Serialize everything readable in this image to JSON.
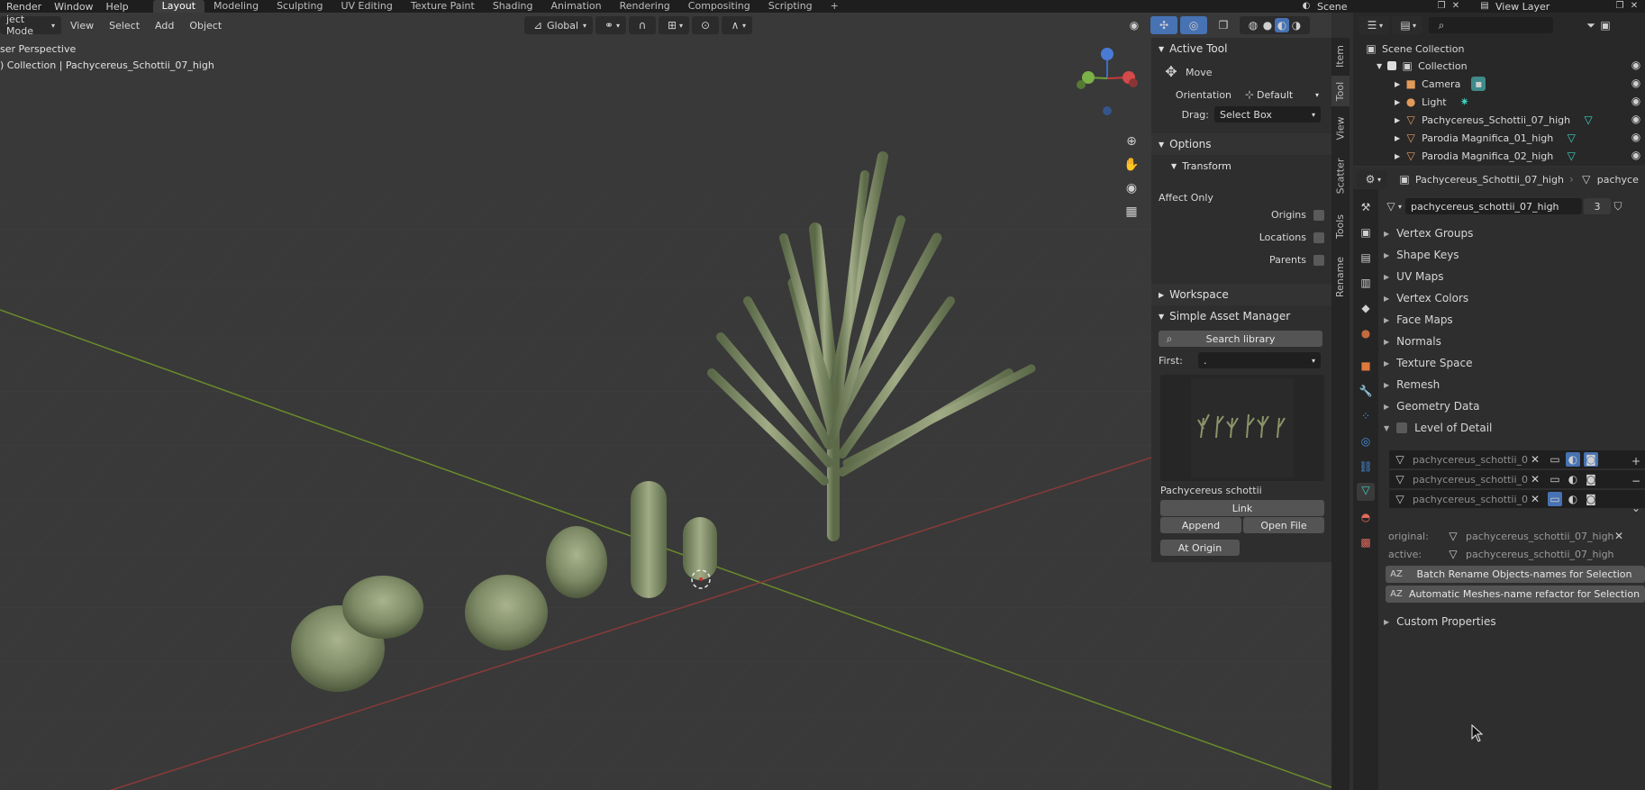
{
  "menubar": {
    "items": [
      "Render",
      "Window",
      "Help"
    ],
    "workspaces": [
      "Layout",
      "Modeling",
      "Sculpting",
      "UV Editing",
      "Texture Paint",
      "Shading",
      "Animation",
      "Rendering",
      "Compositing",
      "Scripting"
    ],
    "add_tab": "+",
    "scene": "Scene",
    "view_layer": "View Layer"
  },
  "viewport_header": {
    "mode": "ject Mode",
    "menus": [
      "View",
      "Select",
      "Add",
      "Object"
    ],
    "orientation": "Global"
  },
  "viewport": {
    "perspective": "ser Perspective",
    "collection_info": ") Collection | Pachycereus_Schottii_07_high"
  },
  "npanel": {
    "active_tool": {
      "title": "Active Tool",
      "tool_name": "Move",
      "orientation_label": "Orientation",
      "orientation_value": "Default",
      "drag_label": "Drag:",
      "drag_value": "Select Box"
    },
    "options": {
      "title": "Options",
      "transform": "Transform",
      "affect_only": "Affect Only",
      "origins": "Origins",
      "locations": "Locations",
      "parents": "Parents"
    },
    "workspace": "Workspace",
    "asset_manager": {
      "title": "Simple Asset Manager",
      "search": "Search library",
      "first_label": "First:",
      "first_value": ".",
      "asset_name": "Pachycereus schottii",
      "link": "Link",
      "append": "Append",
      "open_file": "Open File",
      "at_origin": "At Origin"
    },
    "tabs": [
      "Item",
      "Tool",
      "View",
      "Scatter",
      "Tools",
      "Rename"
    ]
  },
  "outliner": {
    "search_placeholder": "",
    "root": "Scene Collection",
    "items": [
      {
        "name": "Collection",
        "indent": 1
      },
      {
        "name": "Camera",
        "indent": 2
      },
      {
        "name": "Light",
        "indent": 2
      },
      {
        "name": "Pachycereus_Schottii_07_high",
        "indent": 2
      },
      {
        "name": "Parodia Magnifica_01_high",
        "indent": 2
      },
      {
        "name": "Parodia Magnifica_02_high",
        "indent": 2
      }
    ]
  },
  "properties": {
    "object_name": "Pachycereus_Schottii_07_high",
    "mesh_short": "pachyce",
    "mesh_name": "pachycereus_schottii_07_high",
    "users": "3",
    "sections": [
      "Vertex Groups",
      "Shape Keys",
      "UV Maps",
      "Vertex Colors",
      "Face Maps",
      "Normals",
      "Texture Space",
      "Remesh",
      "Geometry Data"
    ],
    "lod_title": "Level of Detail",
    "lod_items": [
      "pachycereus_schottii_0...",
      "pachycereus_schottii_0...",
      "pachycereus_schottii_0..."
    ],
    "original_label": "original:",
    "original_value": "pachycereus_schottii_07_high",
    "active_label": "active:",
    "active_value": "pachycereus_schottii_07_high",
    "batch_rename": "Batch Rename Objects-names for Selection",
    "auto_rename": "Automatic Meshes-name refactor for Selection",
    "custom_props": "Custom Properties"
  },
  "colors": {
    "accent_blue": "#4772b3",
    "axis_red": "#8a3a3a",
    "axis_green": "#6a8a2a",
    "mesh_icon": "#3fd0c0"
  }
}
